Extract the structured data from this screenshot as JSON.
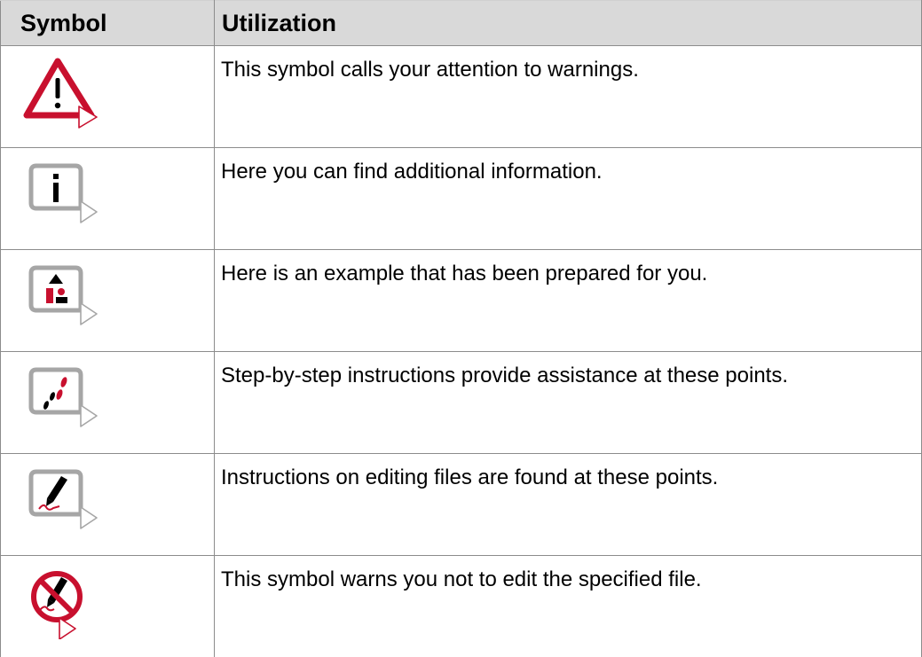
{
  "table": {
    "headers": {
      "symbol": "Symbol",
      "utilization": "Utilization"
    },
    "rows": [
      {
        "icon": "warning-icon",
        "text": "This symbol calls your attention to warnings."
      },
      {
        "icon": "info-icon",
        "text": "Here you can find additional information."
      },
      {
        "icon": "example-icon",
        "text": "Here is an example that has been prepared for you."
      },
      {
        "icon": "step-by-step-icon",
        "text": "Step-by-step instructions provide assistance at these points."
      },
      {
        "icon": "edit-file-icon",
        "text": "Instructions on editing files are found at these points."
      },
      {
        "icon": "do-not-edit-icon",
        "text": "This symbol warns you not to edit the specified file."
      }
    ]
  },
  "colors": {
    "accent_red": "#c8102e",
    "frame_gray": "#a6a6a6",
    "header_bg": "#d9d9d9",
    "border": "#8c8c8c"
  }
}
